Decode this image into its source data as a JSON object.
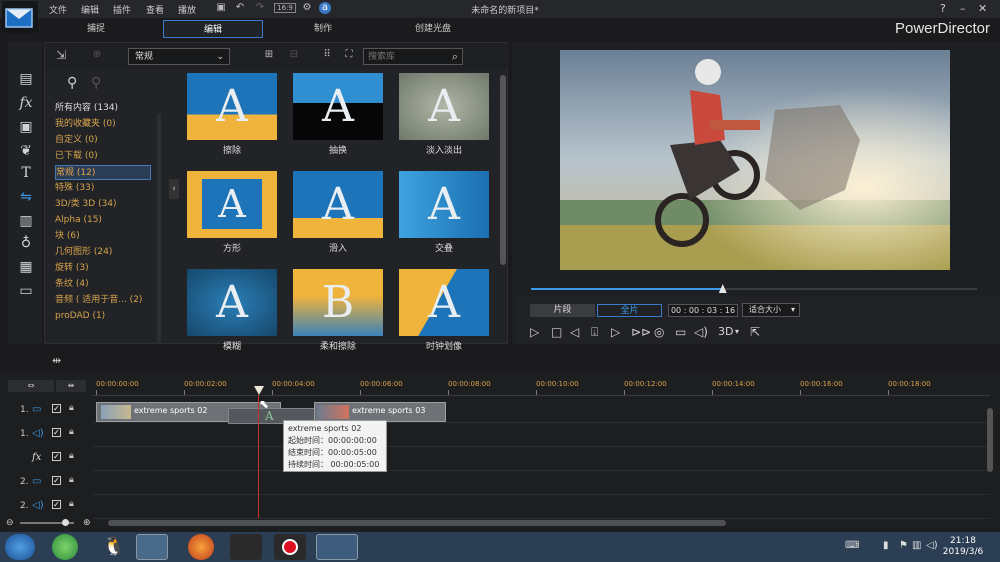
{
  "app": {
    "menu": [
      "文件",
      "编辑",
      "插件",
      "查看",
      "播放"
    ],
    "title": "未命名的新项目*",
    "brand": "PowerDirector",
    "help_label": "?",
    "tabs": [
      "捕捉",
      "编辑",
      "制作",
      "创建光盘"
    ],
    "active_tab": "编辑"
  },
  "library": {
    "category_combo": "常规",
    "search_placeholder": "搜索库",
    "categories": [
      "所有内容 (134)",
      "我的收藏夹 (0)",
      "自定义 (0)",
      "已下载 (0)",
      "常规 (12)",
      "特殊 (33)",
      "3D/类 3D (34)",
      "Alpha (15)",
      "块 (6)",
      "几何图形 (24)",
      "旋转 (3)",
      "条纹 (4)",
      "音频 ( 适用于音...  (2)",
      "proDAD (1)"
    ],
    "selected_category": "常规 (12)",
    "thumbs": [
      {
        "label": "擦除",
        "glyph": "A"
      },
      {
        "label": "抽换",
        "glyph": "A"
      },
      {
        "label": "淡入淡出",
        "glyph": "A"
      },
      {
        "label": "方形",
        "glyph": "A"
      },
      {
        "label": "滑入",
        "glyph": "A"
      },
      {
        "label": "交叠",
        "glyph": "A"
      },
      {
        "label": "模糊",
        "glyph": "A"
      },
      {
        "label": "柔和擦除",
        "glyph": "B"
      },
      {
        "label": "时钟划像",
        "glyph": "A"
      }
    ]
  },
  "preview": {
    "clip_button": "片段",
    "movie_button": "全片",
    "timecode": "00 : 00 : 03 : 16",
    "fit_label": "适合大小",
    "mode_3d": "3D",
    "scrub_progress": 0.43
  },
  "timeline": {
    "ruler": [
      "00:00:00:00",
      "00:00:02:00",
      "00:00:04:00",
      "00:00:06:00",
      "00:00:08:00",
      "00:00:10:00",
      "00:00:12:00",
      "00:00:14:00",
      "00:00:16:00",
      "00:00:18:00"
    ],
    "track_labels": [
      "1.",
      "1.",
      "",
      "2.",
      "2."
    ],
    "clip1": "extreme sports 02",
    "clip2": "extreme sports 03",
    "transition_glyph": "A",
    "tooltip": {
      "name": "extreme sports 02",
      "start": "起始时间：00:00:00:00",
      "end": "结束时间：00:00:05:00",
      "duration": "持续时间：  00:00:05:00"
    }
  },
  "taskbar": {
    "time": "21:18",
    "date": "2019/3/6"
  },
  "colors": {
    "accent": "#3b79c9",
    "category_text": "#d6a34b",
    "ruler_text": "#d5a24a"
  }
}
